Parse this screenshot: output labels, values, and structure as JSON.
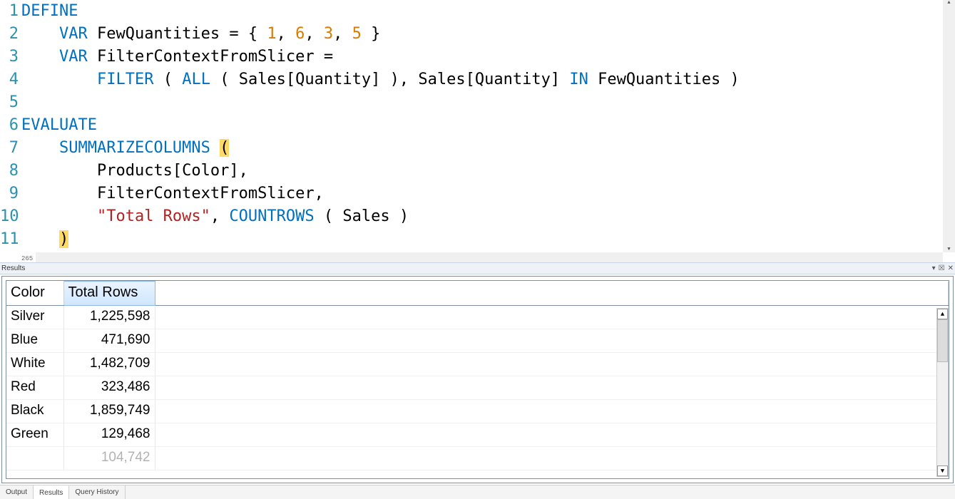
{
  "editor": {
    "lines": [
      1,
      2,
      3,
      4,
      5,
      6,
      7,
      8,
      9,
      10,
      11
    ],
    "tokens": {
      "DEFINE": "DEFINE",
      "VAR": "VAR",
      "FewQuantities": "FewQuantities",
      "eq": "=",
      "lb": "{",
      "rb": "}",
      "n1": "1",
      "n6": "6",
      "n3": "3",
      "n5": "5",
      "FilterContextFromSlicer": "FilterContextFromSlicer",
      "FILTER": "FILTER",
      "ALL": "ALL",
      "SalesQuantity": "Sales[Quantity]",
      "IN": "IN",
      "EVALUATE": "EVALUATE",
      "SUMMARIZECOLUMNS": "SUMMARIZECOLUMNS",
      "ProductsColor": "Products[Color]",
      "TotalRowsStr": "\"Total Rows\"",
      "COUNTROWS": "COUNTROWS",
      "Sales": "Sales",
      "lp": "(",
      "rp": ")",
      "comma": ","
    },
    "zoom": "265 %"
  },
  "resultsPanel": {
    "title": "Results",
    "controls": {
      "dropdown": "▾",
      "pin": "☒",
      "close": "✕"
    }
  },
  "grid": {
    "columns": [
      "Color",
      "Total Rows"
    ],
    "selectedCol": 1,
    "rows": [
      {
        "color": "Silver",
        "total": "1,225,598"
      },
      {
        "color": "Blue",
        "total": "471,690"
      },
      {
        "color": "White",
        "total": "1,482,709"
      },
      {
        "color": "Red",
        "total": "323,486"
      },
      {
        "color": "Black",
        "total": "1,859,749"
      },
      {
        "color": "Green",
        "total": "129,468"
      }
    ],
    "partial": {
      "total": "104,742"
    }
  },
  "tabs": {
    "output": "Output",
    "results": "Results",
    "history": "Query History",
    "active": "Results"
  }
}
